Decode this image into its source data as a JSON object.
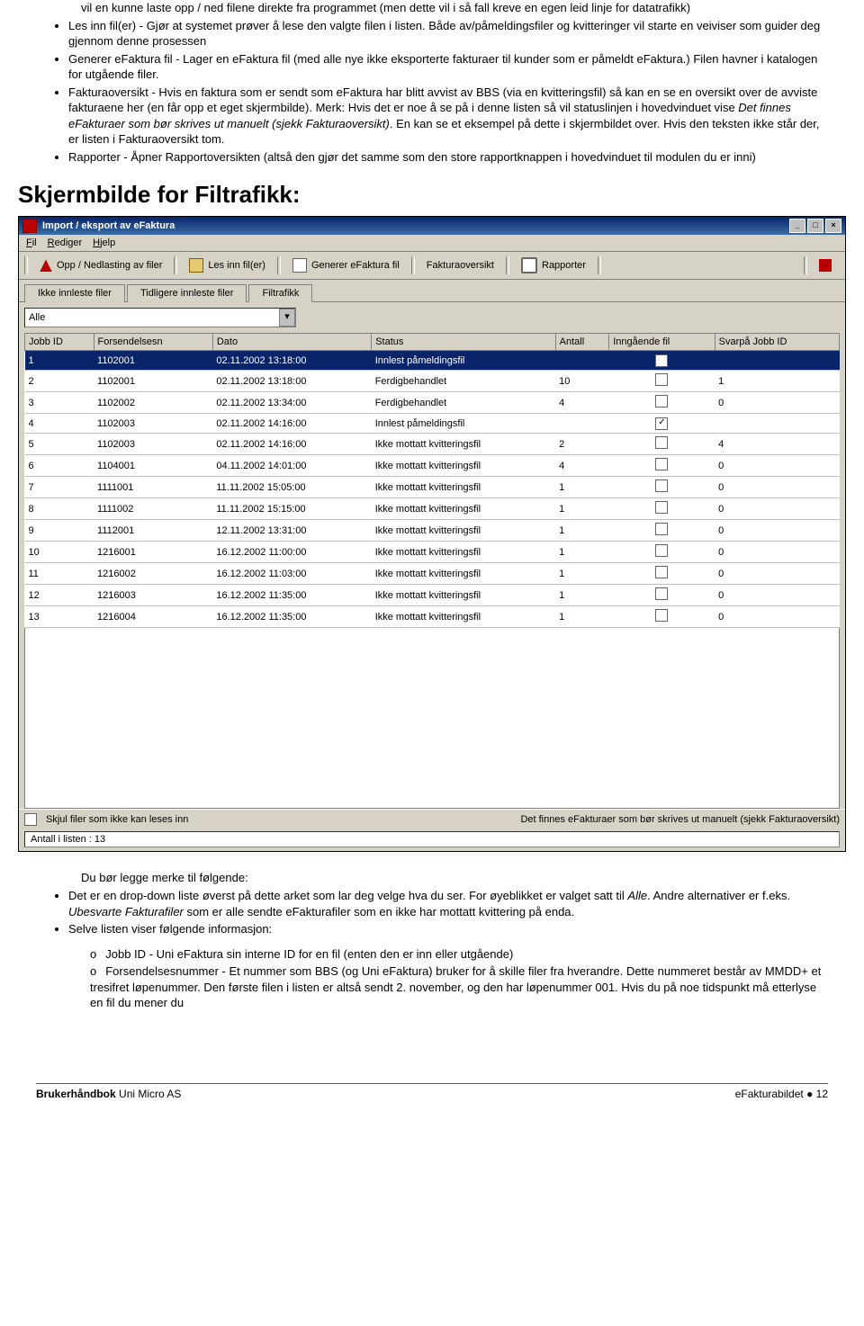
{
  "intro": {
    "pre_line": "vil en kunne laste opp / ned filene direkte fra programmet (men dette vil i så fall kreve en egen leid linje for datatrafikk)",
    "bullets": [
      "Les inn fil(er) - Gjør at systemet prøver å lese den valgte filen i listen. Både av/påmeldingsfiler og kvitteringer vil starte en veiviser som guider deg gjennom denne prosessen",
      "Generer eFaktura fil - Lager en eFaktura fil (med alle nye ikke eksporterte fakturaer til kunder som er påmeldt eFaktura.) Filen havner i katalogen for utgående filer.",
      "",
      "Rapporter - Åpner Rapportoversikten (altså den gjør det samme som den store rapportknappen i hovedvinduet til modulen du er inni)"
    ],
    "b3": {
      "lead": "Fakturaoversikt - Hvis en faktura som er sendt som eFaktura har blitt avvist av BBS (via en kvitteringsfil) så kan en se en oversikt over de avviste fakturaene her (en får opp et eget skjermbilde). Merk: Hvis det er noe å se på i denne listen så vil statuslinjen i hovedvinduet vise ",
      "ital": "Det finnes eFakturaer som bør skrives ut manuelt (sjekk Fakturaoversikt)",
      "tail": ". En kan se et eksempel på dette i skjermbildet over. Hvis den teksten ikke står der, er listen i Fakturaoversikt tom."
    }
  },
  "heading": "Skjermbilde for Filtrafikk:",
  "app": {
    "title": "Import / eksport av eFaktura",
    "menu": {
      "fil": "Fil",
      "rediger": "Rediger",
      "hjelp": "Hjelp"
    },
    "toolbar": {
      "opp": "Opp / Nedlasting av filer",
      "les": "Les inn fil(er)",
      "gen": "Generer eFaktura fil",
      "fak": "Fakturaoversikt",
      "rap": "Rapporter"
    },
    "tabs": {
      "t1": "Ikke innleste filer",
      "t2": "Tidligere innleste filer",
      "t3": "Filtrafikk"
    },
    "filter": "Alle",
    "cols": {
      "c1": "Jobb ID",
      "c2": "Forsendelsesn",
      "c3": "Dato",
      "c4": "Status",
      "c5": "Antall",
      "c6": "Inngående fil",
      "c7": "Svarpå Jobb ID"
    },
    "rows": [
      {
        "id": "1",
        "f": "1102001",
        "d": "02.11.2002 13:18:00",
        "s": "Innlest påmeldingsfil",
        "a": "",
        "inn": true,
        "sv": ""
      },
      {
        "id": "2",
        "f": "1102001",
        "d": "02.11.2002 13:18:00",
        "s": "Ferdigbehandlet",
        "a": "10",
        "inn": false,
        "sv": "1"
      },
      {
        "id": "3",
        "f": "1102002",
        "d": "02.11.2002 13:34:00",
        "s": "Ferdigbehandlet",
        "a": "4",
        "inn": false,
        "sv": "0"
      },
      {
        "id": "4",
        "f": "1102003",
        "d": "02.11.2002 14:16:00",
        "s": "Innlest påmeldingsfil",
        "a": "",
        "inn": true,
        "sv": ""
      },
      {
        "id": "5",
        "f": "1102003",
        "d": "02.11.2002 14:16:00",
        "s": "Ikke mottatt kvitteringsfil",
        "a": "2",
        "inn": false,
        "sv": "4"
      },
      {
        "id": "6",
        "f": "1104001",
        "d": "04.11.2002 14:01:00",
        "s": "Ikke mottatt kvitteringsfil",
        "a": "4",
        "inn": false,
        "sv": "0"
      },
      {
        "id": "7",
        "f": "1111001",
        "d": "11.11.2002 15:05:00",
        "s": "Ikke mottatt kvitteringsfil",
        "a": "1",
        "inn": false,
        "sv": "0"
      },
      {
        "id": "8",
        "f": "1111002",
        "d": "11.11.2002 15:15:00",
        "s": "Ikke mottatt kvitteringsfil",
        "a": "1",
        "inn": false,
        "sv": "0"
      },
      {
        "id": "9",
        "f": "1112001",
        "d": "12.11.2002 13:31:00",
        "s": "Ikke mottatt kvitteringsfil",
        "a": "1",
        "inn": false,
        "sv": "0"
      },
      {
        "id": "10",
        "f": "1216001",
        "d": "16.12.2002 11:00:00",
        "s": "Ikke mottatt kvitteringsfil",
        "a": "1",
        "inn": false,
        "sv": "0"
      },
      {
        "id": "11",
        "f": "1216002",
        "d": "16.12.2002 11:03:00",
        "s": "Ikke mottatt kvitteringsfil",
        "a": "1",
        "inn": false,
        "sv": "0"
      },
      {
        "id": "12",
        "f": "1216003",
        "d": "16.12.2002 11:35:00",
        "s": "Ikke mottatt kvitteringsfil",
        "a": "1",
        "inn": false,
        "sv": "0"
      },
      {
        "id": "13",
        "f": "1216004",
        "d": "16.12.2002 11:35:00",
        "s": "Ikke mottatt kvitteringsfil",
        "a": "1",
        "inn": false,
        "sv": "0"
      }
    ],
    "status": {
      "skjul": "Skjul filer som ikke kan leses inn",
      "finnes": "Det finnes eFakturaer som bør skrives ut manuelt (sjekk Fakturaoversikt)",
      "antall": "Antall i listen : 13"
    }
  },
  "after": {
    "lead": "Du bør legge merke til følgende:",
    "b1a": "Det er en drop-down liste øverst på dette arket som lar deg velge hva du ser. For øyeblikket er valget satt til ",
    "b1i1": "Alle",
    "b1b": ". Andre alternativer er f.eks. ",
    "b1i2": "Ubesvarte Fakturafiler",
    "b1c": " som er alle sendte eFakturafiler som en ikke har mottatt kvittering på enda.",
    "b2": "Selve listen viser følgende informasjon:",
    "sub": [
      "Jobb ID - Uni eFaktura sin interne ID for en fil (enten den er inn eller utgående)",
      "Forsendelsesnummer - Et nummer som BBS (og Uni eFaktura) bruker for å skille filer fra hverandre. Dette nummeret består av MMDD+ et tresifret løpenummer. Den første filen i listen er altså sendt 2. november, og den har løpenummer 001. Hvis du på noe tidspunkt må etterlyse en fil du mener du"
    ]
  },
  "footer": {
    "left_b": "Brukerhåndbok",
    "left": " Uni Micro AS",
    "right": "eFakturabildet  ●  12"
  }
}
